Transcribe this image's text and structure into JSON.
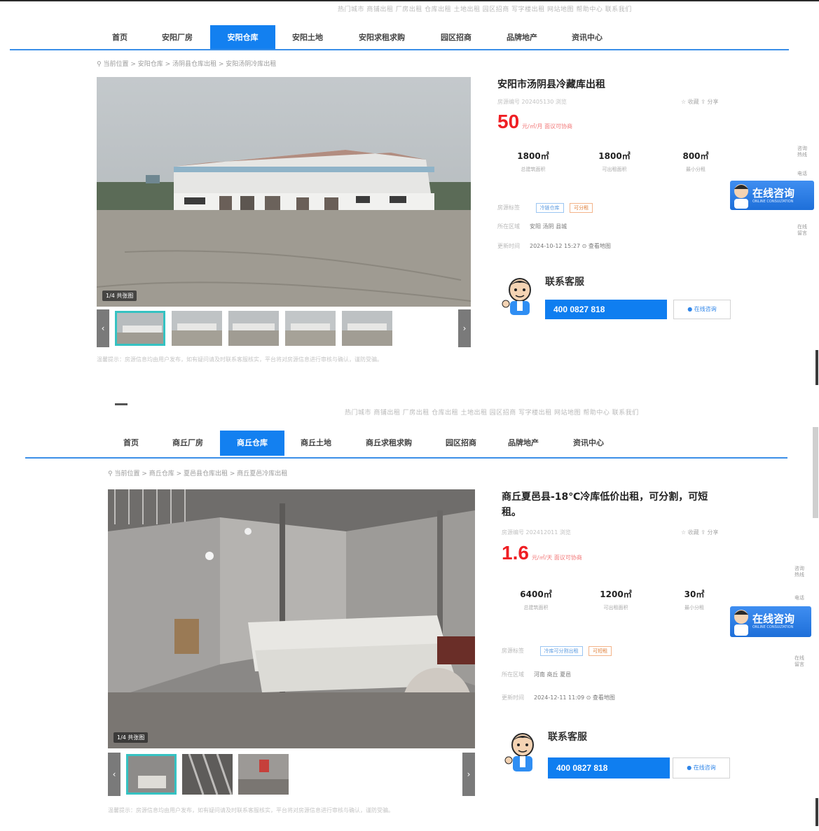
{
  "sections": [
    {
      "top_links": "热门城市   商铺出租   厂房出租   仓库出租   土地出租   园区招商   写字楼出租   网站地图   帮助中心   联系我们",
      "nav": [
        "首页",
        "安阳厂房",
        "安阳仓库",
        "安阳土地",
        "安阳求租求购",
        "园区招商",
        "品牌地产",
        "资讯中心"
      ],
      "nav_active": 2,
      "breadcrumb": "当前位置 > 安阳仓库 > 汤阴县仓库出租 > 安阳汤阴冷库出租",
      "photo_count": "1/4 共张图",
      "notice": "温馨提示：房源信息均由用户发布，如有疑问请及时联系客服核实，平台将对房源信息进行审核与确认，谨防受骗。",
      "title_lines": [
        "安阳市汤阴县冷藏库出租"
      ],
      "meta": "房源编号 202405130  浏览",
      "fav": "☆ 收藏   ⇪ 分享",
      "price": {
        "num": "50",
        "unit": "元/㎡/月  面议可协商"
      },
      "stats": [
        {
          "value": "1800㎡",
          "label": "总建筑面积"
        },
        {
          "value": "1800㎡",
          "label": "可出租面积"
        },
        {
          "value": "800㎡",
          "label": "最小分租"
        }
      ],
      "rows": [
        {
          "label": "房源标签",
          "tags": [
            "冷链仓库",
            "可分租"
          ]
        },
        {
          "label": "所在区域",
          "value": "安阳 汤阴 县城"
        },
        {
          "label": "更新时间",
          "value": "2024-10-12 15:27   ⊙ 查看地图"
        }
      ],
      "cs_title": "联系客服",
      "phone": "400 0827 818",
      "online_btn": "● 在线咨询",
      "consult": {
        "text": "在线咨询",
        "sub": "ONLINE CONSULTATION"
      },
      "side_links": [
        "咨询热线",
        "电话",
        "在线留言"
      ]
    },
    {
      "top_links": "热门城市   商铺出租   厂房出租   仓库出租   土地出租   园区招商   写字楼出租   网站地图   帮助中心   联系我们",
      "nav": [
        "首页",
        "商丘厂房",
        "商丘仓库",
        "商丘土地",
        "商丘求租求购",
        "园区招商",
        "品牌地产",
        "资讯中心"
      ],
      "nav_active": 2,
      "breadcrumb": "当前位置 > 商丘仓库 > 夏邑县仓库出租 > 商丘夏邑冷库出租",
      "photo_count": "1/4 共张图",
      "notice": "温馨提示：房源信息均由用户发布，如有疑问请及时联系客服核实，平台将对房源信息进行审核与确认，谨防受骗。",
      "title_lines": [
        "商丘夏邑县-18℃冷库低价出租，可分割，可短",
        "租。"
      ],
      "meta": "房源编号 202412011  浏览",
      "fav": "☆ 收藏   ⇪ 分享",
      "price": {
        "num": "1.6",
        "unit": "元/㎡/天  面议可协商"
      },
      "stats": [
        {
          "value": "6400㎡",
          "label": "总建筑面积"
        },
        {
          "value": "1200㎡",
          "label": "可出租面积"
        },
        {
          "value": "30㎡",
          "label": "最小分租"
        }
      ],
      "rows": [
        {
          "label": "房源标签",
          "tags": [
            "冷库可分割出租",
            "可短租"
          ]
        },
        {
          "label": "所在区域",
          "value": "河南 商丘 夏邑"
        },
        {
          "label": "更新时间",
          "value": "2024-12-11 11:09   ⊙ 查看地图"
        }
      ],
      "cs_title": "联系客服",
      "phone": "400 0827 818",
      "online_btn": "● 在线咨询",
      "consult": {
        "text": "在线咨询",
        "sub": "ONLINE CONSULTATION"
      },
      "side_links": [
        "咨询热线",
        "电话",
        "在线留言"
      ]
    }
  ],
  "colors": {
    "accent": "#1380f0",
    "price": "#ef1f24",
    "rule": "#3b8fe8"
  }
}
